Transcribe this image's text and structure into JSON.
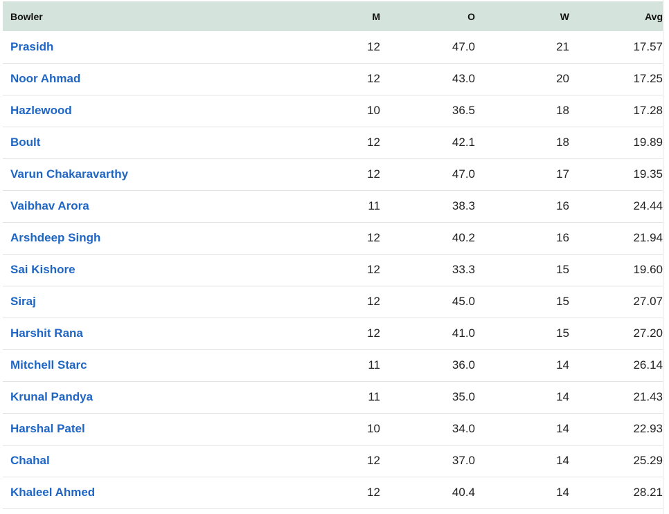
{
  "table": {
    "headers": {
      "bowler": "Bowler",
      "matches": "M",
      "overs": "O",
      "wickets": "W",
      "average": "Avg"
    },
    "rows": [
      {
        "bowler": "Prasidh",
        "m": "12",
        "o": "47.0",
        "w": "21",
        "avg": "17.57"
      },
      {
        "bowler": "Noor Ahmad",
        "m": "12",
        "o": "43.0",
        "w": "20",
        "avg": "17.25"
      },
      {
        "bowler": "Hazlewood",
        "m": "10",
        "o": "36.5",
        "w": "18",
        "avg": "17.28"
      },
      {
        "bowler": "Boult",
        "m": "12",
        "o": "42.1",
        "w": "18",
        "avg": "19.89"
      },
      {
        "bowler": "Varun Chakaravarthy",
        "m": "12",
        "o": "47.0",
        "w": "17",
        "avg": "19.35"
      },
      {
        "bowler": "Vaibhav Arora",
        "m": "11",
        "o": "38.3",
        "w": "16",
        "avg": "24.44"
      },
      {
        "bowler": "Arshdeep Singh",
        "m": "12",
        "o": "40.2",
        "w": "16",
        "avg": "21.94"
      },
      {
        "bowler": "Sai Kishore",
        "m": "12",
        "o": "33.3",
        "w": "15",
        "avg": "19.60"
      },
      {
        "bowler": "Siraj",
        "m": "12",
        "o": "45.0",
        "w": "15",
        "avg": "27.07"
      },
      {
        "bowler": "Harshit Rana",
        "m": "12",
        "o": "41.0",
        "w": "15",
        "avg": "27.20"
      },
      {
        "bowler": "Mitchell Starc",
        "m": "11",
        "o": "36.0",
        "w": "14",
        "avg": "26.14"
      },
      {
        "bowler": "Krunal Pandya",
        "m": "11",
        "o": "35.0",
        "w": "14",
        "avg": "21.43"
      },
      {
        "bowler": "Harshal Patel",
        "m": "10",
        "o": "34.0",
        "w": "14",
        "avg": "22.93"
      },
      {
        "bowler": "Chahal",
        "m": "12",
        "o": "37.0",
        "w": "14",
        "avg": "25.29"
      },
      {
        "bowler": "Khaleel Ahmed",
        "m": "12",
        "o": "40.4",
        "w": "14",
        "avg": "28.21"
      }
    ]
  },
  "colors": {
    "header_background": "#d4e3dc",
    "link": "#1f66c4",
    "row_divider": "#e3e3e3"
  }
}
